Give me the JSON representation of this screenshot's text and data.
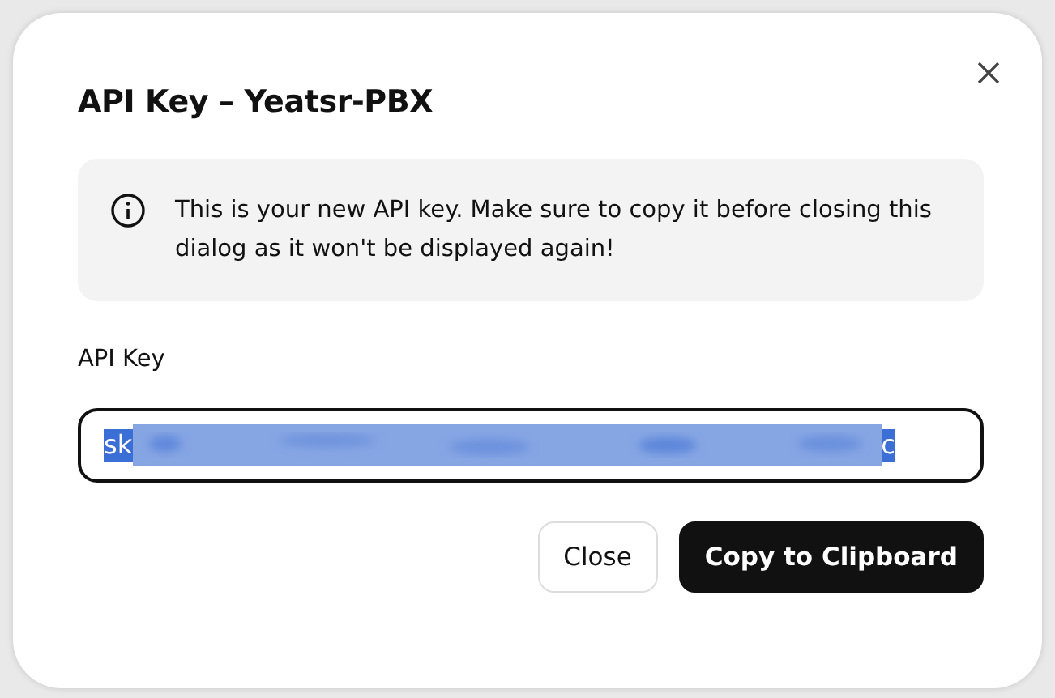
{
  "dialog": {
    "title": "API Key – Yeatsr-PBX",
    "info_message": "This is your new API key. Make sure to copy it before closing this dialog as it won't be displayed again!",
    "field": {
      "label": "API Key",
      "value_start": "sk",
      "value_end": "c",
      "selected": true
    },
    "buttons": [
      {
        "label": "Close",
        "kind": "secondary"
      },
      {
        "label": "Copy to Clipboard",
        "kind": "primary"
      }
    ]
  }
}
